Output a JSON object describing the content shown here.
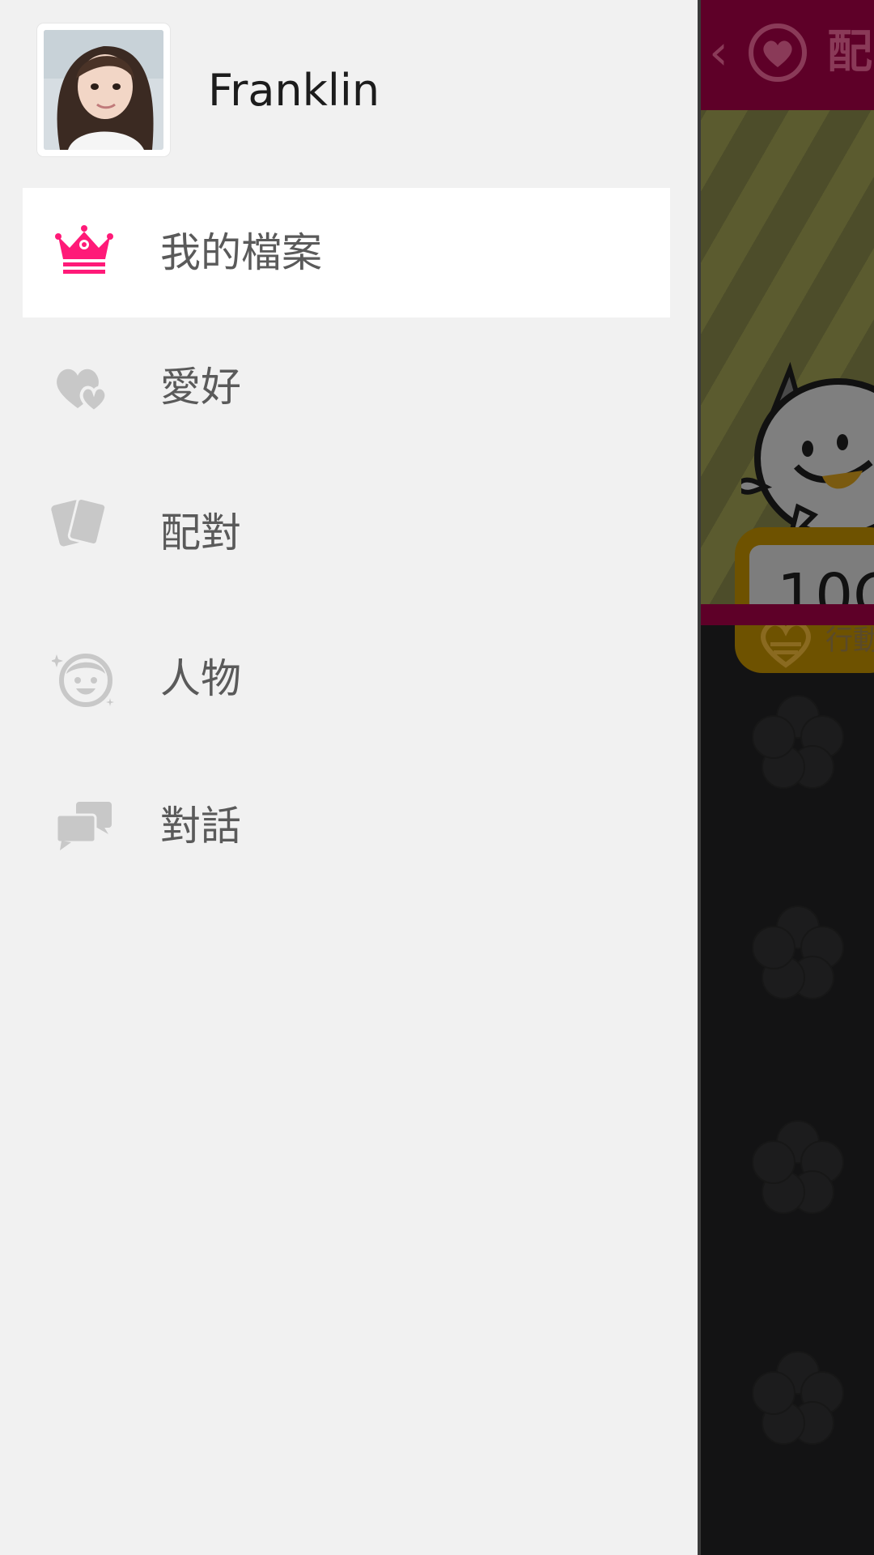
{
  "drawer": {
    "profile": {
      "name": "Franklin",
      "avatar_alt": "profile photo"
    },
    "menu": [
      {
        "label": "我的檔案",
        "icon": "crown-icon",
        "active": true
      },
      {
        "label": "愛好",
        "icon": "hearts-icon",
        "active": false
      },
      {
        "label": "配對",
        "icon": "cards-icon",
        "active": false
      },
      {
        "label": "人物",
        "icon": "smiley-face-icon",
        "active": false
      },
      {
        "label": "對話",
        "icon": "chat-bubbles-icon",
        "active": false
      }
    ],
    "colors": {
      "accent": "#ff1a78",
      "inactive_icon": "#c8c8c8",
      "label": "#5a5a5a",
      "background": "#f1f1f1"
    }
  },
  "content": {
    "topbar": {
      "back_icon": "chevron-left-icon",
      "logo_icon": "heart-circle-icon",
      "title_partial": "配"
    },
    "counter": {
      "value_partial": "10C",
      "label_partial": "行動"
    },
    "colors": {
      "topbar": "#5e0028",
      "background": "#131314"
    }
  }
}
